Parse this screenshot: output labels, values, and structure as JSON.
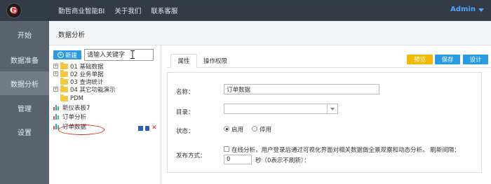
{
  "header": {
    "logo_glyph": "G",
    "nav": [
      "勤哲商业智能BI",
      "关于我们",
      "联系客服"
    ],
    "user": "Admin"
  },
  "sidebar": {
    "items": [
      {
        "label": "开始",
        "active": false
      },
      {
        "label": "数据准备",
        "active": false
      },
      {
        "label": "数据分析",
        "active": true
      },
      {
        "label": "管理",
        "active": false
      },
      {
        "label": "设置",
        "active": false
      }
    ]
  },
  "page": {
    "title": "数据分析"
  },
  "tree_panel": {
    "new_button": "新建",
    "search_placeholder": "请输入关键字",
    "items": [
      {
        "label": "01 基础数据",
        "type": "folder",
        "expandable": true
      },
      {
        "label": "02 业务单据",
        "type": "folder",
        "expandable": true
      },
      {
        "label": "03 查询统计",
        "type": "folder",
        "expandable": false
      },
      {
        "label": "04 其它功能演示",
        "type": "folder",
        "expandable": true
      },
      {
        "label": "PDM",
        "type": "folder",
        "expandable": false
      },
      {
        "label": "新仪表板7",
        "type": "chart",
        "expandable": false
      },
      {
        "label": "订单分析",
        "type": "chart",
        "expandable": false
      },
      {
        "label": "订单数据",
        "type": "chart",
        "expandable": false,
        "selected": true
      }
    ],
    "row_actions": [
      "save-icon",
      "lock-icon",
      "delete-icon"
    ],
    "row_action_delete_glyph": "✕"
  },
  "tabs": [
    {
      "label": "属性",
      "active": true
    },
    {
      "label": "操作权限",
      "active": false
    }
  ],
  "toolbar": {
    "preview": "预览",
    "save": "保存",
    "design": "设计",
    "colors": {
      "preview": "#f5b800",
      "save": "#2a9ae3",
      "design": "#2a9ae3"
    }
  },
  "form": {
    "name_label": "名称：",
    "name_value": "订单数据",
    "dir_label": "目录：",
    "dir_value": "",
    "status_label": "状态：",
    "status_options": [
      {
        "label": "启用",
        "checked": true
      },
      {
        "label": "停用",
        "checked": false
      }
    ],
    "publish_label": "发布方式：",
    "publish_online_label": "在线分析，用户登录后通过可视化界面对相关数据做全景观察和动态分析。 刷新间隔：",
    "refresh_value": "0",
    "refresh_unit": "秒（0表示不刷新）："
  }
}
